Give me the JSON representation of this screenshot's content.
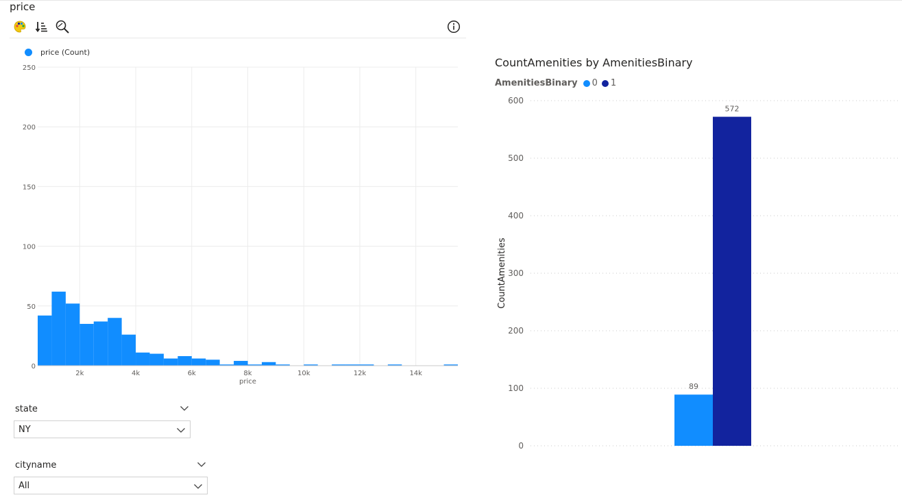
{
  "histogram": {
    "title": "price",
    "toolbar": {
      "icons": [
        "palette-icon",
        "sort-icon",
        "zoom-icon"
      ],
      "info_icon": "info-icon"
    },
    "legend_label": "price (Count)",
    "color": "#118DFF"
  },
  "bar_chart_panel": {
    "title": "CountAmenities by AmenitiesBinary",
    "legend_title": "AmenitiesBinary",
    "legend_items": [
      {
        "label": "0",
        "color": "#118DFF"
      },
      {
        "label": "1",
        "color": "#12239E"
      }
    ]
  },
  "slicers": [
    {
      "label": "state",
      "value": "NY"
    },
    {
      "label": "cityname",
      "value": "All"
    }
  ],
  "chart_data": [
    {
      "type": "bar",
      "subtype": "histogram",
      "xlabel": "price",
      "ylabel": "",
      "xlim": [
        500,
        15500
      ],
      "ylim": [
        0,
        250
      ],
      "xticks": [
        2000,
        4000,
        6000,
        8000,
        10000,
        12000,
        14000
      ],
      "xtick_labels": [
        "2k",
        "4k",
        "6k",
        "8k",
        "10k",
        "12k",
        "14k"
      ],
      "yticks": [
        0,
        50,
        100,
        150,
        200,
        250
      ],
      "bin_width": 500,
      "bin_start": 500,
      "series": [
        {
          "name": "price (Count)",
          "values": [
            42,
            62,
            52,
            35,
            37,
            40,
            26,
            11,
            10,
            6,
            8,
            6,
            5,
            1,
            4,
            1,
            3,
            1,
            0,
            1,
            0,
            1,
            1,
            1,
            0,
            1,
            0,
            0,
            0,
            1
          ]
        }
      ],
      "grid": true
    },
    {
      "type": "bar",
      "title": "CountAmenities by AmenitiesBinary",
      "ylabel": "CountAmenities",
      "xlabel": "",
      "ylim": [
        0,
        600
      ],
      "yticks": [
        0,
        100,
        200,
        300,
        400,
        500,
        600
      ],
      "categories": [
        ""
      ],
      "series": [
        {
          "name": "0",
          "values": [
            89
          ],
          "color": "#118DFF"
        },
        {
          "name": "1",
          "values": [
            572
          ],
          "color": "#12239E"
        }
      ],
      "data_labels": true,
      "grid": true
    }
  ]
}
